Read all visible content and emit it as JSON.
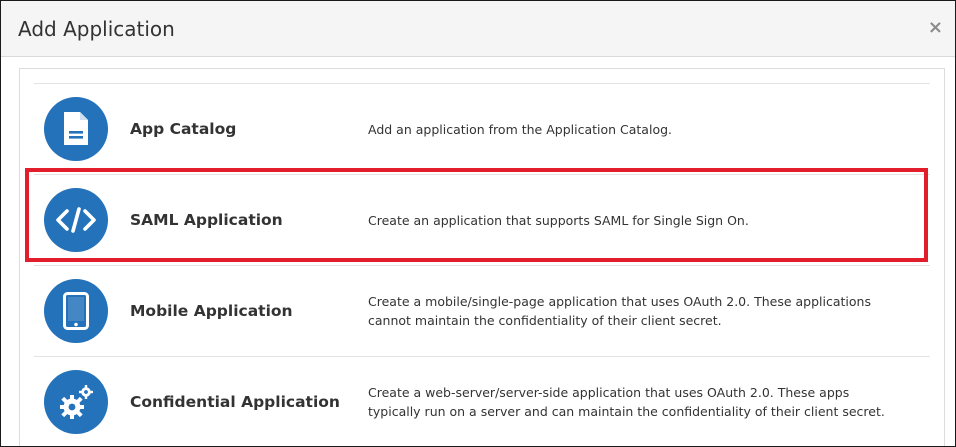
{
  "dialog": {
    "title": "Add Application",
    "close_label": "×"
  },
  "options": [
    {
      "id": "app-catalog",
      "icon": "document-icon",
      "title": "App Catalog",
      "description": "Add an application from the Application Catalog."
    },
    {
      "id": "saml-application",
      "icon": "code-icon",
      "title": "SAML Application",
      "description": "Create an application that supports SAML for Single Sign On.",
      "highlighted": true
    },
    {
      "id": "mobile-application",
      "icon": "tablet-icon",
      "title": "Mobile Application",
      "description": "Create a mobile/single-page application that uses OAuth 2.0. These applications cannot maintain the confidentiality of their client secret."
    },
    {
      "id": "confidential-application",
      "icon": "gears-icon",
      "title": "Confidential Application",
      "description": "Create a web-server/server-side application that uses OAuth 2.0. These apps typically run on a server and can maintain the confidentiality of their client secret."
    }
  ],
  "colors": {
    "icon_circle": "#2472ba",
    "highlight_border": "#e21e2c"
  }
}
